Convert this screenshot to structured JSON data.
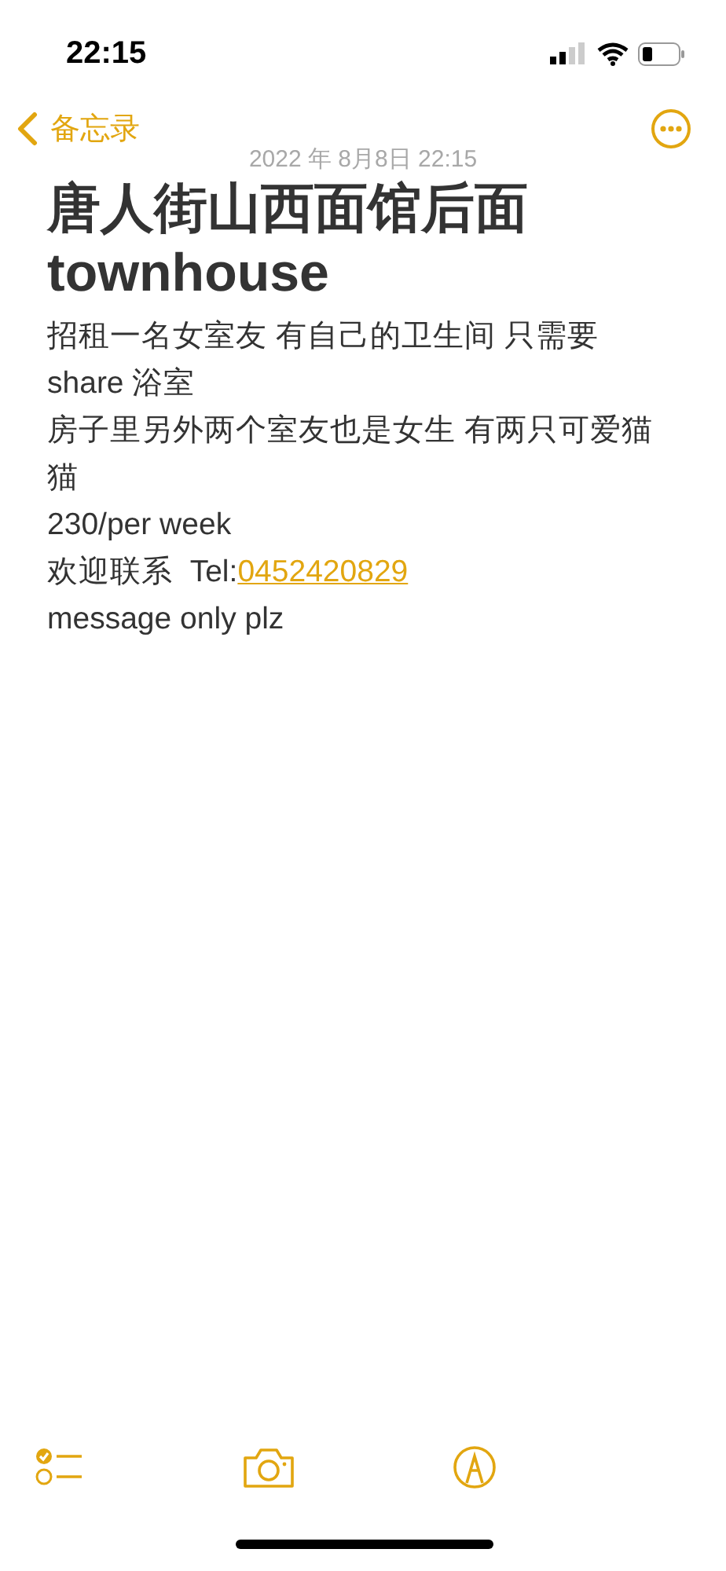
{
  "status_bar": {
    "time": "22:15"
  },
  "nav": {
    "back_label": "备忘录"
  },
  "note": {
    "date": "2022 年 8月8日 22:15",
    "title_lines": [
      "唐人街山西面馆后面",
      "townhouse"
    ],
    "lines": [
      {
        "kind": "text",
        "text": "招租一名女室友 有自己的卫生间 只需要 share 浴室"
      },
      {
        "kind": "text",
        "text": "房子里另外两个室友也是女生 有两只可爱猫猫"
      },
      {
        "kind": "text",
        "text": "230/per week"
      },
      {
        "kind": "contact",
        "text": "欢迎联系  Tel:",
        "link": "0452420829"
      },
      {
        "kind": "text",
        "text": "message only plz"
      }
    ]
  }
}
